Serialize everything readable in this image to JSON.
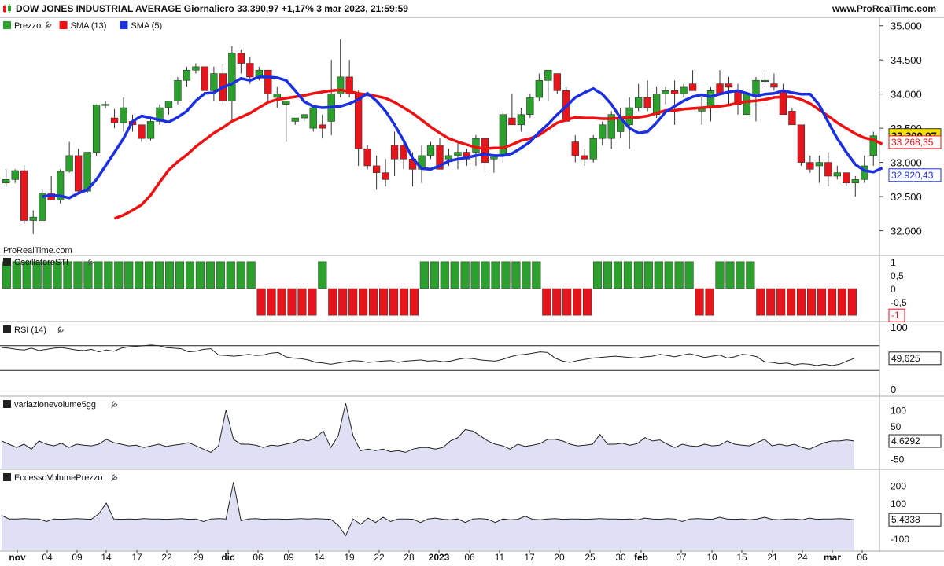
{
  "header": {
    "title": "DOW JONES INDUSTRIAL AVERAGE Giornaliero 33.390,97 +1,17% 3 mar 2023, 21:59:59",
    "site": "www.ProRealTime.com"
  },
  "watermark": "ProRealTime.com",
  "colors": {
    "up": "#2ca02c",
    "down": "#e8141c",
    "sma13": "#ee1111",
    "sma5": "#1a2fe0",
    "oscillator_up": "#2ca02c",
    "oscillator_down": "#e8141c",
    "area_fill": "#dfe0f3"
  },
  "icons": [
    "candles-icon",
    "wrench-icon"
  ],
  "chart_data": [
    {
      "type": "candlestick",
      "panel": "price",
      "legend": [
        {
          "name": "Prezzo",
          "swatch": "#2ca02c"
        },
        {
          "name": "SMA (13)",
          "swatch": "#ee1111"
        },
        {
          "name": "SMA (5)",
          "swatch": "#1a2fe0"
        }
      ],
      "y_ticks": [
        "35.000",
        "34.500",
        "34.000",
        "33.500",
        "33.000",
        "32.500",
        "32.000"
      ],
      "ylim": [
        31650,
        35100
      ],
      "last_labels": {
        "price": "33.390,97",
        "sma13": "33.268,35",
        "sma5": "32.920,43"
      },
      "x_ticks": [
        "nov",
        "04",
        "09",
        "14",
        "17",
        "22",
        "29",
        "dic",
        "06",
        "09",
        "14",
        "19",
        "22",
        "28",
        "2023",
        "06",
        "11",
        "17",
        "20",
        "25",
        "30",
        "feb",
        "07",
        "10",
        "15",
        "21",
        "24",
        "mar",
        "06"
      ],
      "ohlc": [
        [
          32700,
          32900,
          32650,
          32750
        ],
        [
          32750,
          32900,
          32700,
          32880
        ],
        [
          32880,
          32960,
          32100,
          32150
        ],
        [
          32150,
          32300,
          31950,
          32200
        ],
        [
          32150,
          32600,
          32150,
          32550
        ],
        [
          32550,
          32800,
          32450,
          32450
        ],
        [
          32450,
          32900,
          32400,
          32870
        ],
        [
          32870,
          33300,
          32850,
          33100
        ],
        [
          33100,
          33200,
          32550,
          32580
        ],
        [
          32580,
          33150,
          32550,
          33150
        ],
        [
          33150,
          33850,
          33100,
          33840
        ],
        [
          33840,
          33900,
          33790,
          33850
        ],
        [
          33650,
          33780,
          33500,
          33580
        ],
        [
          33580,
          33950,
          33450,
          33800
        ],
        [
          33600,
          33700,
          33450,
          33550
        ],
        [
          33550,
          33550,
          33300,
          33350
        ],
        [
          33350,
          33650,
          33320,
          33600
        ],
        [
          33600,
          33850,
          33550,
          33800
        ],
        [
          33800,
          33900,
          33700,
          33900
        ],
        [
          33900,
          34250,
          33850,
          34200
        ],
        [
          34200,
          34400,
          34100,
          34350
        ],
        [
          34350,
          34450,
          34300,
          34400
        ],
        [
          34400,
          34300,
          34000,
          34050
        ],
        [
          34050,
          34400,
          33900,
          34300
        ],
        [
          34300,
          34450,
          33850,
          33900
        ],
        [
          33900,
          34700,
          33600,
          34600
        ],
        [
          34600,
          34650,
          34300,
          34450
        ],
        [
          34450,
          34550,
          34150,
          34250
        ],
        [
          34250,
          34400,
          34200,
          34350
        ],
        [
          34350,
          34250,
          33900,
          34000
        ],
        [
          33950,
          34100,
          33800,
          34000
        ],
        [
          33850,
          33900,
          33300,
          33900
        ],
        [
          33600,
          33650,
          33550,
          33650
        ],
        [
          33650,
          33700,
          33600,
          33700
        ],
        [
          33500,
          33800,
          33450,
          33800
        ],
        [
          33550,
          33700,
          33350,
          33500
        ],
        [
          33600,
          34500,
          33400,
          34000
        ],
        [
          34000,
          34800,
          33950,
          34250
        ],
        [
          34250,
          34500,
          33950,
          34000
        ],
        [
          34000,
          34050,
          32950,
          33200
        ],
        [
          33200,
          33250,
          32900,
          32950
        ],
        [
          32950,
          33100,
          32600,
          32850
        ],
        [
          32850,
          33050,
          32650,
          32750
        ],
        [
          33250,
          33450,
          32800,
          33050
        ],
        [
          33250,
          33300,
          32900,
          33050
        ],
        [
          33050,
          33150,
          32650,
          32900
        ],
        [
          32900,
          33250,
          32700,
          33100
        ],
        [
          33100,
          33300,
          33050,
          33250
        ],
        [
          33250,
          33350,
          32900,
          32900
        ],
        [
          33050,
          33200,
          32950,
          33100
        ],
        [
          33100,
          33300,
          32900,
          33150
        ],
        [
          33150,
          33200,
          32950,
          33050
        ],
        [
          33150,
          33400,
          32950,
          33350
        ],
        [
          33350,
          33300,
          32850,
          33000
        ],
        [
          33050,
          33100,
          32850,
          33100
        ],
        [
          33100,
          33750,
          33000,
          33700
        ],
        [
          33650,
          34000,
          33550,
          33550
        ],
        [
          33550,
          33800,
          33450,
          33700
        ],
        [
          33700,
          34000,
          33650,
          33950
        ],
        [
          33950,
          34300,
          33900,
          34200
        ],
        [
          34200,
          34350,
          33900,
          34350
        ],
        [
          34300,
          34250,
          34000,
          34050
        ],
        [
          34050,
          34100,
          33600,
          33600
        ],
        [
          33300,
          33400,
          33000,
          33100
        ],
        [
          33100,
          33200,
          32950,
          33050
        ],
        [
          33050,
          33400,
          33000,
          33350
        ],
        [
          33350,
          33600,
          33250,
          33550
        ],
        [
          33350,
          33750,
          33200,
          33700
        ],
        [
          33450,
          33800,
          33350,
          33650
        ],
        [
          33550,
          33950,
          33200,
          33800
        ],
        [
          33800,
          34150,
          33750,
          33950
        ],
        [
          33950,
          34200,
          33750,
          33800
        ],
        [
          33700,
          34100,
          33650,
          34000
        ],
        [
          34000,
          34100,
          33850,
          34050
        ],
        [
          34050,
          34200,
          33550,
          34000
        ],
        [
          34000,
          34150,
          33950,
          34100
        ],
        [
          34150,
          34350,
          34050,
          34050
        ],
        [
          33750,
          33950,
          33550,
          33800
        ],
        [
          33800,
          34100,
          33600,
          34050
        ],
        [
          34150,
          34350,
          34000,
          34000
        ],
        [
          34150,
          34250,
          33850,
          34100
        ],
        [
          34050,
          34150,
          33700,
          33850
        ],
        [
          33700,
          34050,
          33650,
          34000
        ],
        [
          34000,
          34250,
          33600,
          34200
        ],
        [
          34200,
          34350,
          34100,
          34200
        ],
        [
          34150,
          34300,
          34050,
          34100
        ],
        [
          34050,
          34150,
          33800,
          33700
        ],
        [
          33750,
          33800,
          33600,
          33550
        ],
        [
          33550,
          33500,
          32950,
          33000
        ],
        [
          33000,
          33100,
          32850,
          32900
        ],
        [
          32950,
          33100,
          32700,
          33000
        ],
        [
          33000,
          33150,
          32650,
          32800
        ],
        [
          32800,
          32950,
          32750,
          32850
        ],
        [
          32850,
          32850,
          32650,
          32700
        ],
        [
          32700,
          32800,
          32500,
          32750
        ],
        [
          32750,
          33100,
          32700,
          32950
        ],
        [
          33100,
          33450,
          32950,
          33390
        ]
      ],
      "sma13": [
        null,
        null,
        null,
        null,
        null,
        null,
        null,
        null,
        null,
        null,
        null,
        null,
        32180,
        32230,
        32300,
        32380,
        32520,
        32710,
        32890,
        33010,
        33110,
        33230,
        33330,
        33430,
        33510,
        33600,
        33660,
        33720,
        33800,
        33880,
        33920,
        33940,
        33960,
        33980,
        34010,
        34030,
        34050,
        34060,
        34040,
        34010,
        33990,
        33970,
        33940,
        33880,
        33800,
        33720,
        33620,
        33520,
        33430,
        33350,
        33300,
        33260,
        33220,
        33200,
        33210,
        33210,
        33260,
        33320,
        33350,
        33400,
        33490,
        33580,
        33620,
        33660,
        33650,
        33650,
        33640,
        33640,
        33650,
        33660,
        33660,
        33680,
        33720,
        33760,
        33760,
        33780,
        33790,
        33800,
        33810,
        33820,
        33840,
        33870,
        33890,
        33900,
        33920,
        33950,
        33960,
        33960,
        33920,
        33860,
        33770,
        33680,
        33580,
        33500,
        33420,
        33360,
        33330,
        33268
      ],
      "sma5": [
        null,
        null,
        null,
        null,
        32500,
        32520,
        32510,
        32480,
        32550,
        32600,
        32750,
        32950,
        33150,
        33350,
        33600,
        33680,
        33650,
        33620,
        33590,
        33660,
        33750,
        33900,
        34010,
        34020,
        34100,
        34150,
        34230,
        34200,
        34250,
        34250,
        34240,
        34200,
        34050,
        33890,
        33820,
        33800,
        33810,
        33820,
        33860,
        33920,
        34010,
        33900,
        33750,
        33550,
        33320,
        33060,
        32910,
        32900,
        32950,
        33020,
        33050,
        33070,
        33100,
        33120,
        33100,
        33100,
        33130,
        33210,
        33300,
        33440,
        33560,
        33700,
        33820,
        33950,
        34020,
        34080,
        34000,
        33850,
        33650,
        33500,
        33430,
        33450,
        33580,
        33740,
        33820,
        33900,
        33960,
        33990,
        33960,
        34000,
        34030,
        34050,
        34010,
        33970,
        34000,
        34010,
        34050,
        34020,
        34000,
        34000,
        33840,
        33590,
        33350,
        33150,
        32970,
        32880,
        32860,
        32920
      ]
    },
    {
      "type": "bar",
      "panel": "oscillator",
      "name": "OscillatoreSTI",
      "y_ticks": [
        "1",
        "0,5",
        "0",
        "-0,5",
        "-1"
      ],
      "ylim": [
        -1.2,
        1.2
      ],
      "last_label": "-1",
      "values": [
        1,
        1,
        1,
        1,
        1,
        1,
        1,
        1,
        1,
        1,
        1,
        1,
        1,
        1,
        1,
        1,
        1,
        1,
        1,
        1,
        1,
        1,
        1,
        1,
        1,
        -1,
        -1,
        -1,
        -1,
        -1,
        -1,
        1,
        -1,
        -1,
        -1,
        -1,
        -1,
        -1,
        -1,
        -1,
        -1,
        1,
        1,
        1,
        1,
        1,
        1,
        1,
        1,
        1,
        1,
        1,
        1,
        -1,
        -1,
        -1,
        -1,
        -1,
        1,
        1,
        1,
        1,
        1,
        1,
        1,
        1,
        1,
        1,
        -1,
        -1,
        1,
        1,
        1,
        1,
        -1,
        -1,
        -1,
        -1,
        -1,
        -1,
        -1,
        -1,
        -1,
        -1
      ]
    },
    {
      "type": "line",
      "panel": "rsi",
      "name": "RSI (14)",
      "y_ticks": [
        "100",
        "0"
      ],
      "ylim": [
        0,
        100
      ],
      "levels": [
        70,
        30
      ],
      "last_label": "49,625",
      "values": [
        67,
        66,
        64,
        63,
        66,
        62,
        64,
        66,
        67,
        65,
        63,
        62,
        64,
        60,
        63,
        61,
        66,
        68,
        69,
        70,
        71,
        70,
        67,
        66,
        65,
        60,
        61,
        64,
        65,
        55,
        54,
        53,
        54,
        56,
        54,
        55,
        58,
        59,
        52,
        50,
        49,
        47,
        43,
        42,
        40,
        42,
        44,
        46,
        45,
        43,
        44,
        45,
        46,
        43,
        45,
        46,
        47,
        45,
        46,
        44,
        45,
        48,
        50,
        49,
        47,
        46,
        45,
        48,
        52,
        55,
        56,
        58,
        60,
        59,
        50,
        45,
        43,
        46,
        48,
        50,
        51,
        52,
        53,
        52,
        51,
        50,
        52,
        53,
        56,
        54,
        52,
        55,
        57,
        54,
        51,
        53,
        55,
        50,
        52,
        56,
        55,
        52,
        44,
        43,
        41,
        42,
        39,
        41,
        40,
        38,
        40,
        38,
        40,
        45,
        49.625
      ]
    },
    {
      "type": "area",
      "panel": "variazionevolume5gg",
      "name": "variazionevolume5gg",
      "y_ticks": [
        "100",
        "50",
        "0",
        "-50"
      ],
      "ylim": [
        -70,
        130
      ],
      "last_label": "4,6292",
      "values": [
        5,
        -5,
        -15,
        -5,
        -20,
        5,
        -5,
        -10,
        -2,
        -15,
        -5,
        -8,
        -10,
        -5,
        10,
        0,
        -5,
        -10,
        -8,
        -15,
        -10,
        -5,
        -12,
        -8,
        -5,
        0,
        -10,
        -20,
        -30,
        -10,
        100,
        10,
        -5,
        -5,
        -8,
        -15,
        -8,
        -10,
        -5,
        0,
        10,
        5,
        15,
        35,
        -15,
        20,
        120,
        20,
        -25,
        -20,
        -25,
        -20,
        -28,
        -25,
        -30,
        -20,
        -15,
        -15,
        -20,
        -15,
        5,
        15,
        40,
        35,
        20,
        5,
        -5,
        -10,
        -20,
        -5,
        -12,
        -8,
        -3,
        10,
        10,
        5,
        -5,
        -10,
        -8,
        -5,
        25,
        -5,
        -5,
        -2,
        -8,
        -3,
        15,
        5,
        8,
        -5,
        -15,
        -5,
        -10,
        -12,
        -5,
        -10,
        -8,
        5,
        -5,
        -8,
        -10,
        0,
        10,
        -10,
        -5,
        -10,
        -5,
        -15,
        -20,
        -10,
        0,
        5,
        5,
        8,
        4.6292
      ]
    },
    {
      "type": "area",
      "panel": "eccessovolumeprezzo",
      "name": "EccessoVolumePrezzo",
      "y_ticks": [
        "200",
        "100",
        "0",
        "-100"
      ],
      "ylim": [
        -150,
        270
      ],
      "last_label": "5,4338",
      "values": [
        30,
        10,
        10,
        12,
        10,
        10,
        -5,
        10,
        8,
        10,
        12,
        10,
        8,
        40,
        100,
        10,
        8,
        10,
        8,
        12,
        10,
        10,
        8,
        10,
        12,
        8,
        10,
        -5,
        10,
        12,
        10,
        220,
        0,
        10,
        12,
        8,
        10,
        10,
        8,
        10,
        12,
        10,
        12,
        10,
        8,
        -25,
        -85,
        10,
        -20,
        15,
        -10,
        20,
        -5,
        10,
        10,
        8,
        -10,
        10,
        15,
        8,
        5,
        10,
        -10,
        10,
        12,
        8,
        -10,
        10,
        5,
        8,
        25,
        8,
        5,
        10,
        12,
        8,
        10,
        10,
        8,
        10,
        12,
        10,
        10,
        8,
        10,
        5,
        15,
        10,
        8,
        12,
        10,
        -5,
        10,
        12,
        10,
        8,
        20,
        10,
        8,
        10,
        5,
        10,
        20,
        8,
        5,
        10,
        10,
        5,
        15,
        8,
        10,
        10,
        12,
        10,
        5.4338
      ]
    }
  ]
}
